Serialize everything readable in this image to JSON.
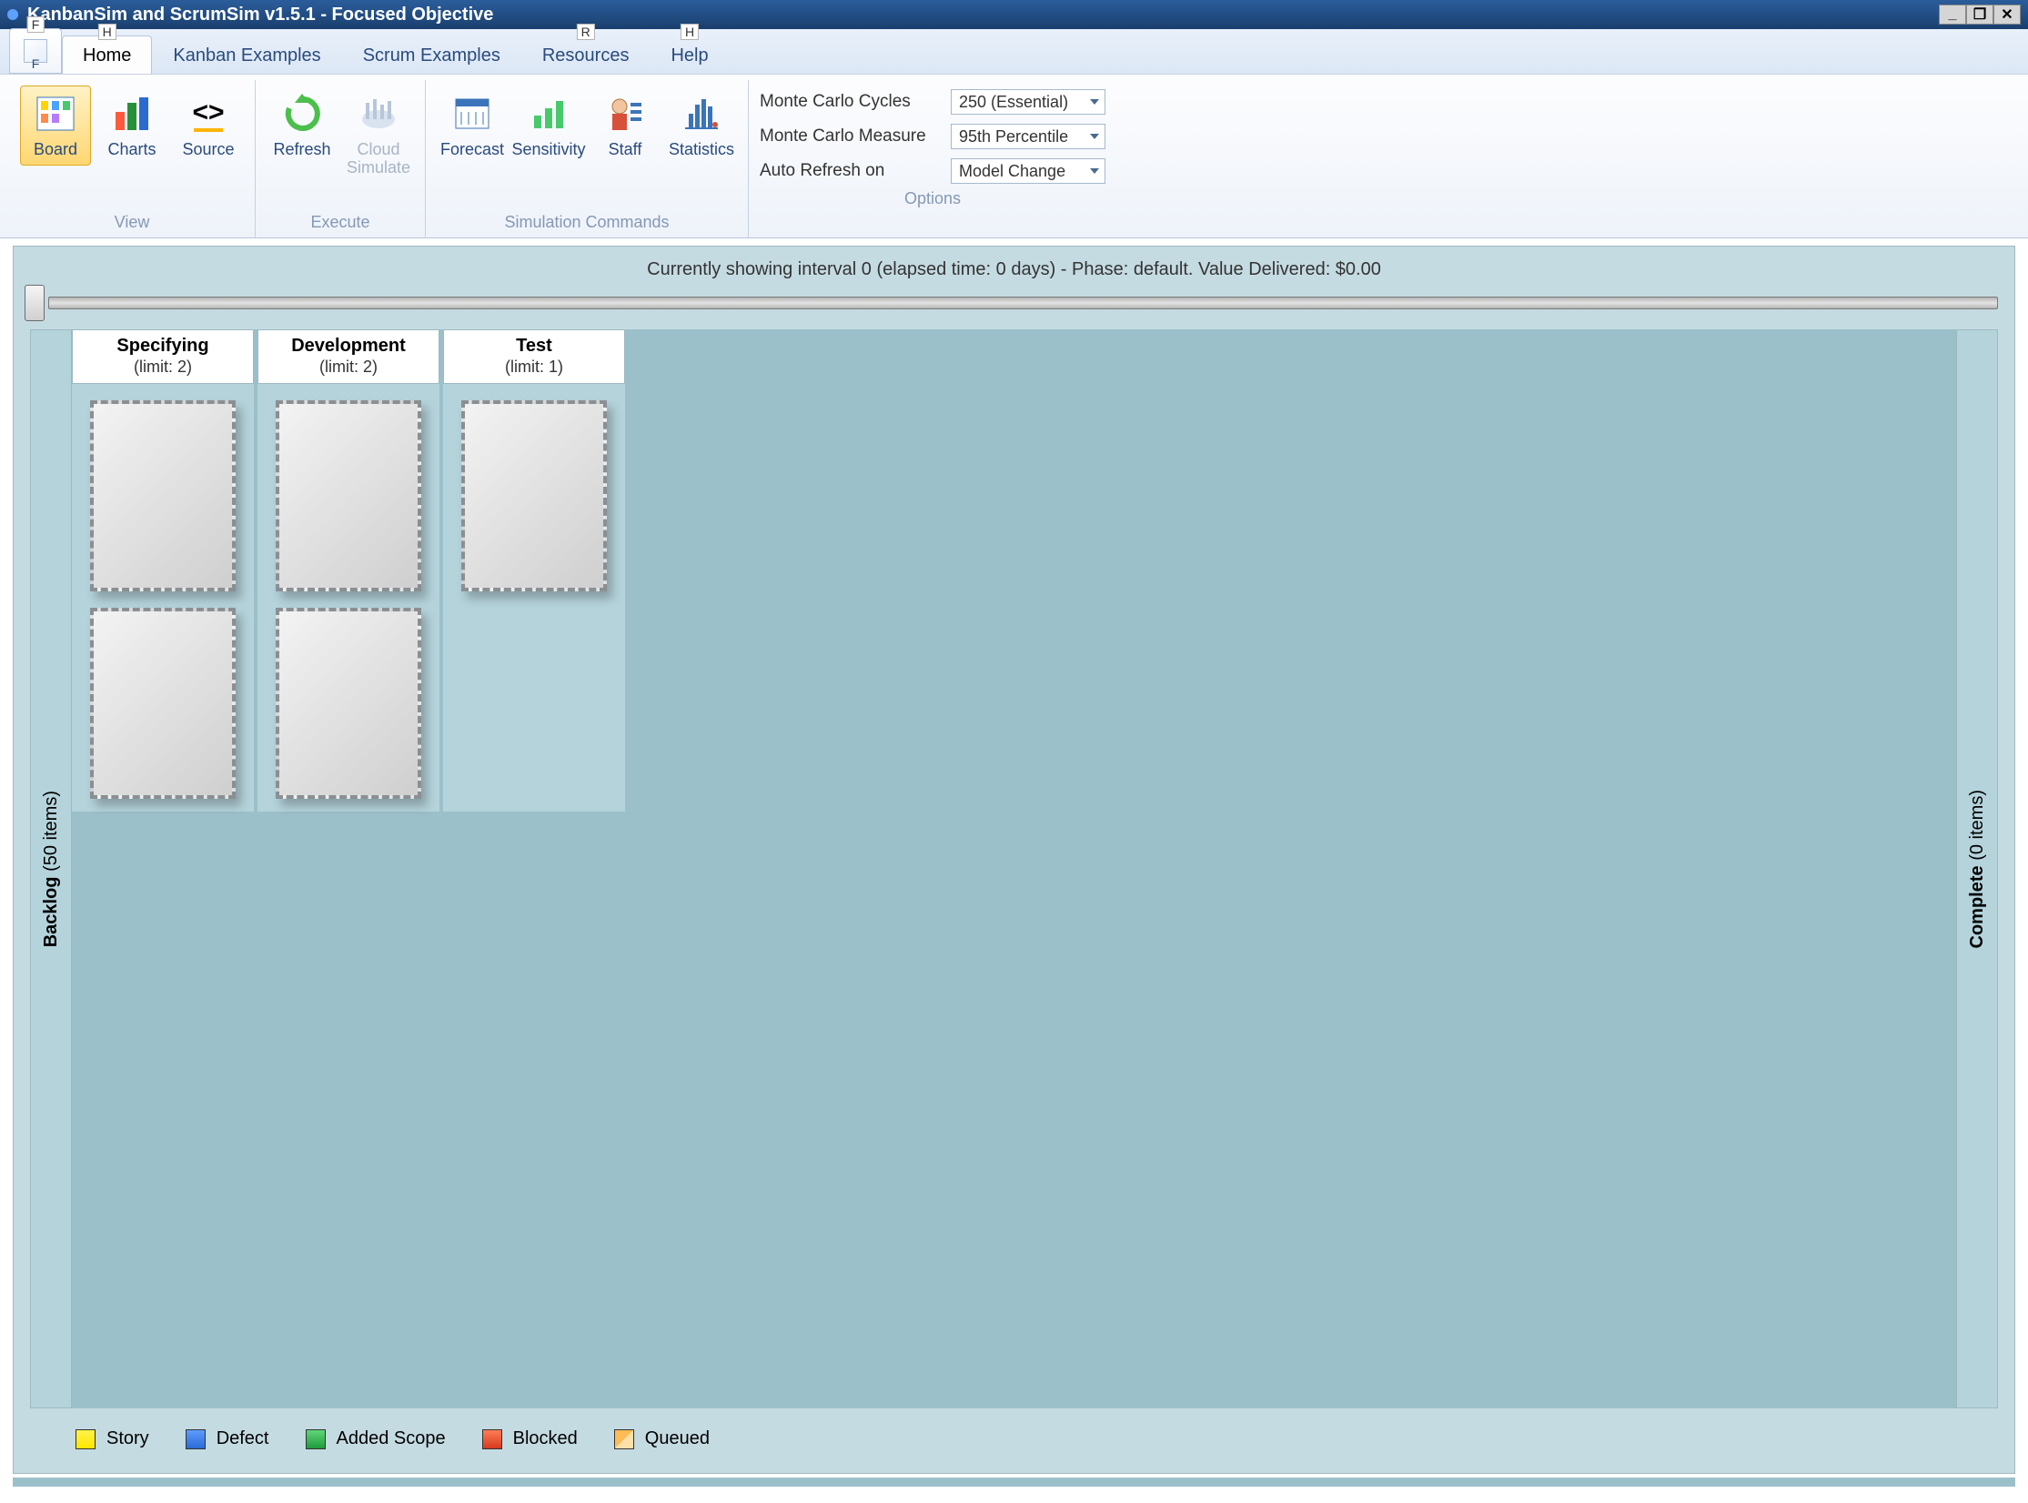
{
  "window": {
    "title": "KanbanSim and ScrumSim v1.5.1 - Focused Objective"
  },
  "ribbon": {
    "file_keytip": "F",
    "tabs": [
      {
        "label": "Home",
        "keytip": "H",
        "active": true
      },
      {
        "label": "Kanban Examples"
      },
      {
        "label": "Scrum Examples"
      },
      {
        "label": "Resources",
        "keytip": "R"
      },
      {
        "label": "Help",
        "keytip": "H"
      }
    ],
    "groups": {
      "view": {
        "label": "View",
        "board": "Board",
        "charts": "Charts",
        "source": "Source"
      },
      "execute": {
        "label": "Execute",
        "refresh": "Refresh",
        "cloud_simulate": "Cloud Simulate"
      },
      "sim": {
        "label": "Simulation Commands",
        "forecast": "Forecast",
        "sensitivity": "Sensitivity",
        "staff": "Staff",
        "statistics": "Statistics"
      },
      "options": {
        "label": "Options",
        "cycles_label": "Monte Carlo Cycles",
        "cycles_value": "250 (Essential)",
        "measure_label": "Monte Carlo Measure",
        "measure_value": "95th Percentile",
        "auto_label": "Auto Refresh on",
        "auto_value": "Model Change"
      }
    }
  },
  "board": {
    "status": "Currently showing interval 0 (elapsed time: 0 days) - Phase: default. Value Delivered: $0.00",
    "backlog": {
      "title": "Backlog",
      "count_label": "(50 items)"
    },
    "complete": {
      "title": "Complete",
      "count_label": "(0 items)"
    },
    "columns": [
      {
        "name": "Specifying",
        "limit": "(limit: 2)",
        "slots": 2
      },
      {
        "name": "Development",
        "limit": "(limit: 2)",
        "slots": 2
      },
      {
        "name": "Test",
        "limit": "(limit: 1)",
        "slots": 1
      }
    ],
    "legend": [
      {
        "label": "Story",
        "class": "sw-story"
      },
      {
        "label": "Defect",
        "class": "sw-defect"
      },
      {
        "label": "Added Scope",
        "class": "sw-added"
      },
      {
        "label": "Blocked",
        "class": "sw-block"
      },
      {
        "label": "Queued",
        "class": "sw-queued"
      }
    ]
  }
}
